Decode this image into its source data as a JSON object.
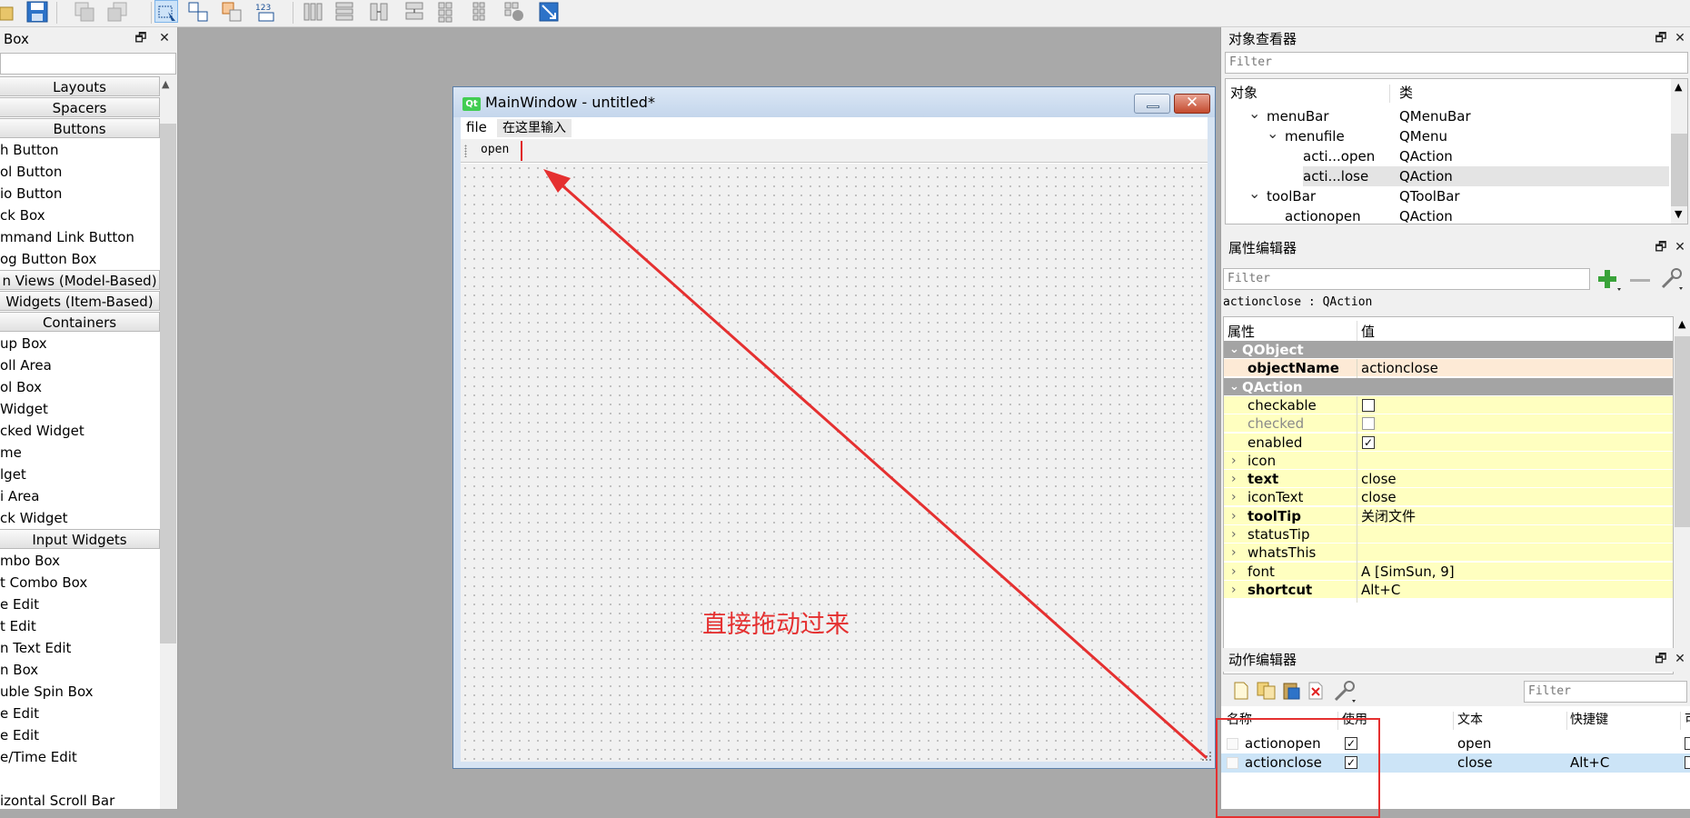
{
  "widget_box": {
    "title": "Box",
    "categories_and_items": [
      {
        "kind": "cat",
        "text": "Layouts"
      },
      {
        "kind": "cat",
        "text": "Spacers"
      },
      {
        "kind": "cat",
        "text": "Buttons"
      },
      {
        "kind": "item",
        "text": "h Button"
      },
      {
        "kind": "item",
        "text": "ol Button"
      },
      {
        "kind": "item",
        "text": "io Button"
      },
      {
        "kind": "item",
        "text": "ck Box"
      },
      {
        "kind": "item",
        "text": "mmand Link Button"
      },
      {
        "kind": "item",
        "text": "og Button Box"
      },
      {
        "kind": "cat",
        "text": "n Views (Model-Based)"
      },
      {
        "kind": "cat",
        "text": "Widgets (Item-Based)"
      },
      {
        "kind": "cat",
        "text": "Containers"
      },
      {
        "kind": "item",
        "text": "up Box"
      },
      {
        "kind": "item",
        "text": "oll Area"
      },
      {
        "kind": "item",
        "text": "ol Box"
      },
      {
        "kind": "item",
        "text": " Widget"
      },
      {
        "kind": "item",
        "text": "cked Widget"
      },
      {
        "kind": "item",
        "text": "me"
      },
      {
        "kind": "item",
        "text": "lget"
      },
      {
        "kind": "item",
        "text": "i Area"
      },
      {
        "kind": "item",
        "text": "ck Widget"
      },
      {
        "kind": "cat",
        "text": "Input Widgets"
      },
      {
        "kind": "item",
        "text": "mbo Box"
      },
      {
        "kind": "item",
        "text": "t Combo Box"
      },
      {
        "kind": "item",
        "text": "e Edit"
      },
      {
        "kind": "item",
        "text": "t Edit"
      },
      {
        "kind": "item",
        "text": "n Text Edit"
      },
      {
        "kind": "item",
        "text": "n Box"
      },
      {
        "kind": "item",
        "text": "uble Spin Box"
      },
      {
        "kind": "item",
        "text": "e Edit"
      },
      {
        "kind": "item",
        "text": "e Edit"
      },
      {
        "kind": "item",
        "text": "e/Time Edit"
      },
      {
        "kind": "item",
        "text": ""
      },
      {
        "kind": "item",
        "text": "izontal Scroll Bar"
      }
    ]
  },
  "main_window": {
    "title": "MainWindow - untitled*",
    "logo_text": "Qt",
    "menu_file": "file",
    "menu_type_here": "在这里输入",
    "toolbar_action": "open",
    "annotation": "直接拖动过来",
    "close_glyph": "✕"
  },
  "object_inspector": {
    "title": "对象查看器",
    "filter_placeholder": "Filter",
    "col_object": "对象",
    "col_class": "类",
    "rows": [
      {
        "name": "menuBar",
        "cls": "QMenuBar",
        "indent": 0,
        "expand": "v",
        "selected": false
      },
      {
        "name": "menufile",
        "cls": "QMenu",
        "indent": 1,
        "expand": "v",
        "selected": false
      },
      {
        "name": "acti...open",
        "cls": "QAction",
        "indent": 2,
        "expand": "",
        "selected": false
      },
      {
        "name": "acti...lose",
        "cls": "QAction",
        "indent": 2,
        "expand": "",
        "selected": true
      },
      {
        "name": "toolBar",
        "cls": "QToolBar",
        "indent": 0,
        "expand": "v",
        "selected": false
      },
      {
        "name": "actionopen",
        "cls": "QAction",
        "indent": 1,
        "expand": "",
        "selected": false
      }
    ]
  },
  "property_editor": {
    "title": "属性编辑器",
    "filter_placeholder": "Filter",
    "object_label": "actionclose : QAction",
    "col_property": "属性",
    "col_value": "值",
    "rows": [
      {
        "type": "group",
        "name": "QObject"
      },
      {
        "type": "prop",
        "name": "objectName",
        "value": "actionclose",
        "bold": true,
        "style": "peach"
      },
      {
        "type": "group",
        "name": "QAction"
      },
      {
        "type": "prop",
        "name": "checkable",
        "check": false,
        "style": "yellow"
      },
      {
        "type": "prop",
        "name": "checked",
        "check": false,
        "disabled": true,
        "style": "yellow"
      },
      {
        "type": "prop",
        "name": "enabled",
        "check": true,
        "style": "yellow"
      },
      {
        "type": "prop",
        "name": "icon",
        "value": "",
        "expand": true,
        "style": "yellow"
      },
      {
        "type": "prop",
        "name": "text",
        "value": "close",
        "expand": true,
        "bold": true,
        "style": "yellow"
      },
      {
        "type": "prop",
        "name": "iconText",
        "value": "close",
        "expand": true,
        "style": "yellow"
      },
      {
        "type": "prop",
        "name": "toolTip",
        "value": "关闭文件",
        "expand": true,
        "bold": true,
        "style": "yellow"
      },
      {
        "type": "prop",
        "name": "statusTip",
        "value": "",
        "expand": true,
        "style": "yellow"
      },
      {
        "type": "prop",
        "name": "whatsThis",
        "value": "",
        "expand": true,
        "style": "yellow"
      },
      {
        "type": "prop",
        "name": "font",
        "value": "A  [SimSun, 9]",
        "expand": true,
        "style": "yellow"
      },
      {
        "type": "prop",
        "name": "shortcut",
        "value": "Alt+C",
        "expand": true,
        "bold": true,
        "style": "yellow"
      }
    ]
  },
  "action_editor": {
    "title": "动作编辑器",
    "filter_placeholder": "Filter",
    "col_name": "名称",
    "col_used": "使用",
    "col_text": "文本",
    "col_shortcut": "快捷键",
    "col_more": "可",
    "rows": [
      {
        "name": "actionopen",
        "used": true,
        "text": "open",
        "shortcut": "",
        "selected": false
      },
      {
        "name": "actionclose",
        "used": true,
        "text": "close",
        "shortcut": "Alt+C",
        "selected": true
      }
    ]
  },
  "colors": {
    "annotation_red": "#e53030",
    "property_group": "#a4a4a4",
    "property_yellow": "#ffffc0",
    "selection_blue": "#cce4f7"
  }
}
